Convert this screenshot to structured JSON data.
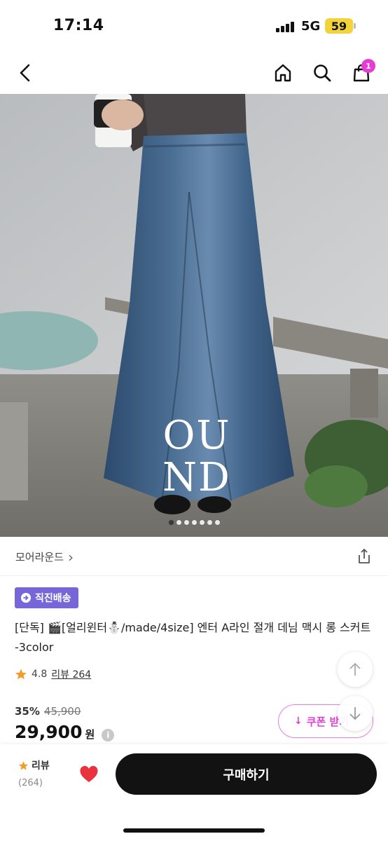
{
  "status_bar": {
    "time": "17:14",
    "network": "5G",
    "battery": "59"
  },
  "nav": {
    "back_icon": "chevron-left-icon",
    "home_icon": "home-icon",
    "search_icon": "search-icon",
    "cart_icon": "shopping-bag-icon",
    "cart_count": "1"
  },
  "product_image": {
    "watermark_line1": "OU",
    "watermark_line2": "ND",
    "slide_count": 7,
    "active_slide": 1
  },
  "brand": {
    "name": "모어라운드",
    "chevron": "›",
    "share_icon": "share-icon"
  },
  "product": {
    "badge": "직진배송",
    "title": "[단독] 🎬[얼리윈터⛄/made/4size] 엔터 A라인 절개 데님 맥시 롱 스커트 -3color",
    "rating": "4.8",
    "review_text": "리뷰 264",
    "discount_rate": "35%",
    "original_price": "45,900",
    "sale_price": "29,900",
    "currency": "원",
    "info_symbol": "i",
    "coupon_label": "쿠폰 받기",
    "coupon_arrow": "↓"
  },
  "floating": {
    "scroll_up_icon": "arrow-up-icon",
    "scroll_down_icon": "arrow-down-icon"
  },
  "bottom_bar": {
    "review_label": "리뷰",
    "review_count": "(264)",
    "buy_label": "구매하기"
  },
  "colors": {
    "accent_pink": "#e23fd8",
    "badge_purple": "#7766d8",
    "heart_red": "#e8333f",
    "star_orange": "#f39c2a",
    "battery_yellow": "#f2d43a"
  }
}
